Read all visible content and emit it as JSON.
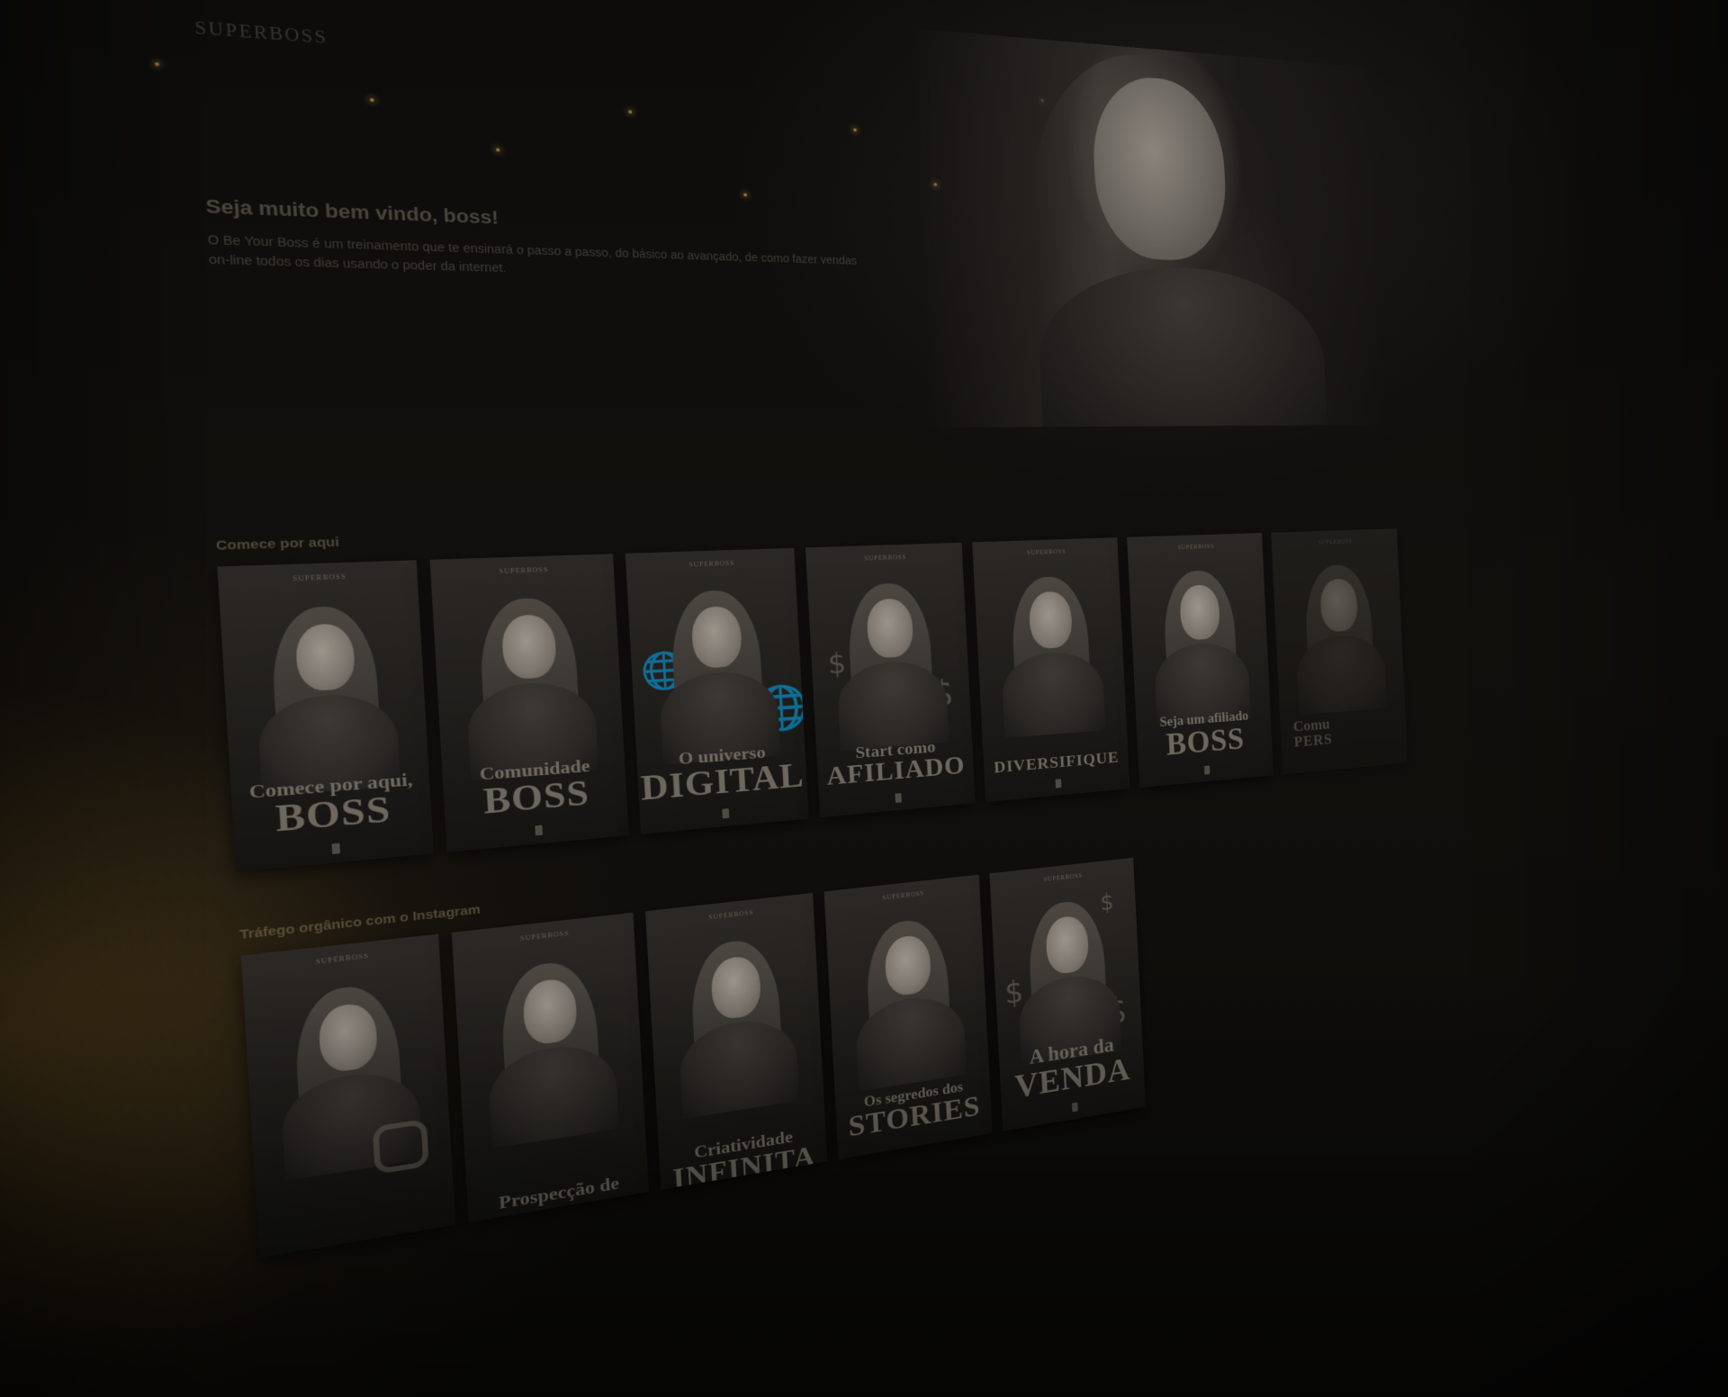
{
  "app": {
    "brand": "SUPERBOSS"
  },
  "hero": {
    "title": "Seja muito bem vindo, boss!",
    "text": "O Be Your Boss é um treinamento que te ensinará o passo a passo, do básico ao avançado, de como fazer vendas on-line todos os dias usando o poder da internet."
  },
  "rows": [
    {
      "title": "Comece por aqui",
      "cards": [
        {
          "logo": "SUPERBOSS",
          "small": "Comece por aqui,",
          "big": "BOSS",
          "deco": ""
        },
        {
          "logo": "SUPERBOSS",
          "small": "Comunidade",
          "big": "BOSS",
          "deco": ""
        },
        {
          "logo": "SUPERBOSS",
          "small": "O universo",
          "big": "DIGITAL",
          "deco": "globe-icon"
        },
        {
          "logo": "SUPERBOSS",
          "small": "Start como",
          "big": "AFILIADO",
          "deco": "dollar-icon"
        },
        {
          "logo": "SUPERBOSS",
          "small": "",
          "big": "DIVERSIFIQUE",
          "deco": ""
        },
        {
          "logo": "SUPERBOSS",
          "small": "Seja um afiliado",
          "big": "BOSS",
          "deco": ""
        },
        {
          "logo": "SUPERBOSS",
          "small": "Comu",
          "big": "PERS",
          "deco": ""
        }
      ]
    },
    {
      "title": "Tráfego orgânico com o Instagram",
      "cards": [
        {
          "logo": "SUPERBOSS",
          "small": "",
          "big": "",
          "deco": "instagram-icon"
        },
        {
          "logo": "SUPERBOSS",
          "small": "Prospecção de",
          "big": "",
          "deco": ""
        },
        {
          "logo": "SUPERBOSS",
          "small": "Criatividade",
          "big": "INFINITA",
          "deco": ""
        },
        {
          "logo": "SUPERBOSS",
          "small": "Os segredos dos",
          "big": "STORIES",
          "deco": ""
        },
        {
          "logo": "SUPERBOSS",
          "small": "A hora da",
          "big": "VENDA",
          "deco": "dollar-icon"
        }
      ]
    }
  ],
  "colors": {
    "accent_gold": "#c9a24a",
    "background": "#0b0a09"
  }
}
